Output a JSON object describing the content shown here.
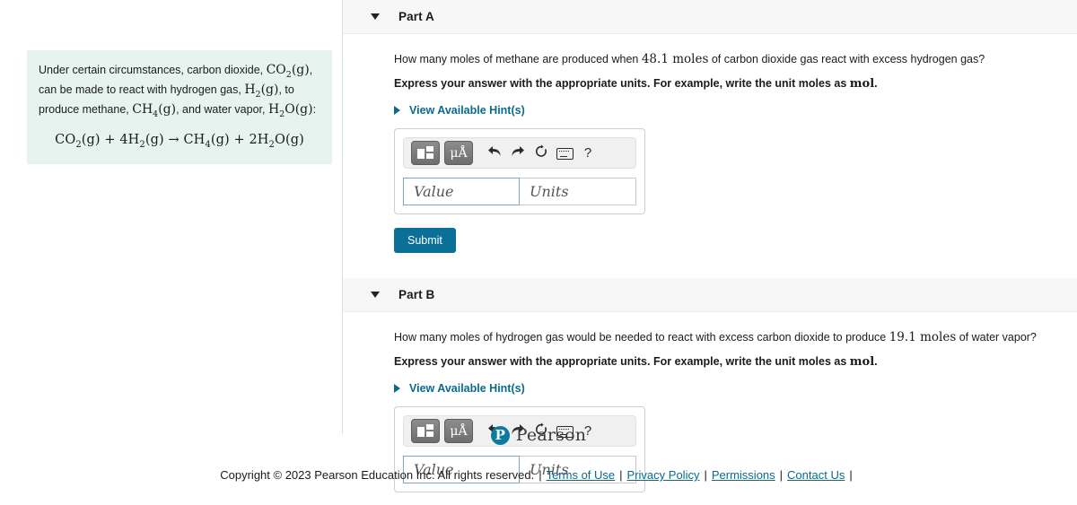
{
  "problem": {
    "intro_1": "Under certain circumstances, carbon dioxide, ",
    "formula_co2": "CO",
    "formula_co2_sub": "2",
    "formula_co2_state": "(g)",
    "intro_2": ", can be made to react with hydrogen gas, ",
    "formula_h2": "H",
    "formula_h2_sub": "2",
    "formula_h2_state": "(g)",
    "intro_3": ", to produce methane, ",
    "formula_ch4": "CH",
    "formula_ch4_sub": "4",
    "formula_ch4_state": "(g)",
    "intro_4": ", and water vapor, ",
    "formula_h2o": "H",
    "formula_h2o_sub": "2",
    "formula_h2o_rest": "O(g)",
    "intro_5": ":",
    "equation": "CO2 (g) + 4H2 (g) → CH4 (g) + 2H2O(g)"
  },
  "part_a": {
    "title": "Part A",
    "question": "How many moles of methane are produced when 48.1 moles of carbon dioxide gas react with excess hydrogen gas?",
    "question_pre": "How many moles of methane are produced when ",
    "question_amount": "48.1",
    "question_unit": "moles",
    "question_post": " of carbon dioxide gas react with excess hydrogen gas?",
    "instruction_pre": "Express your answer with the appropriate units. For example, write the unit moles as ",
    "instruction_unit": "mol",
    "instruction_post": ".",
    "hint_label": "View Available Hint(s)",
    "submit_label": "Submit"
  },
  "part_b": {
    "title": "Part B",
    "question_pre": "How many moles of hydrogen gas would be needed to react with excess carbon dioxide to produce ",
    "question_amount": "19.1",
    "question_unit": "moles",
    "question_post": " of water vapor?",
    "instruction_pre": "Express your answer with the appropriate units. For example, write the unit moles as ",
    "instruction_unit": "mol",
    "instruction_post": ".",
    "hint_label": "View Available Hint(s)"
  },
  "answer_toolbar": {
    "template_button_title": "template-button",
    "units_button_label": "μÅ",
    "undo_icon": "↰",
    "redo_icon": "↱",
    "reset_icon": "↻",
    "keyboard_icon": "keyboard",
    "help_icon": "?"
  },
  "answer_fields": {
    "value_placeholder": "Value",
    "units_placeholder": "Units"
  },
  "footer": {
    "brand": "Pearson",
    "brand_mark": "P",
    "copyright": "Copyright © 2023 Pearson Education Inc. All rights reserved.",
    "links": [
      {
        "label": "Terms of Use"
      },
      {
        "label": "Privacy Policy"
      },
      {
        "label": "Permissions"
      },
      {
        "label": "Contact Us"
      }
    ],
    "separator": "|"
  },
  "colors": {
    "accent_teal": "#0a7098",
    "link_blue": "#0a6a8c",
    "panel_mint": "#e6f3ef",
    "header_gray": "#f7f7f7"
  }
}
